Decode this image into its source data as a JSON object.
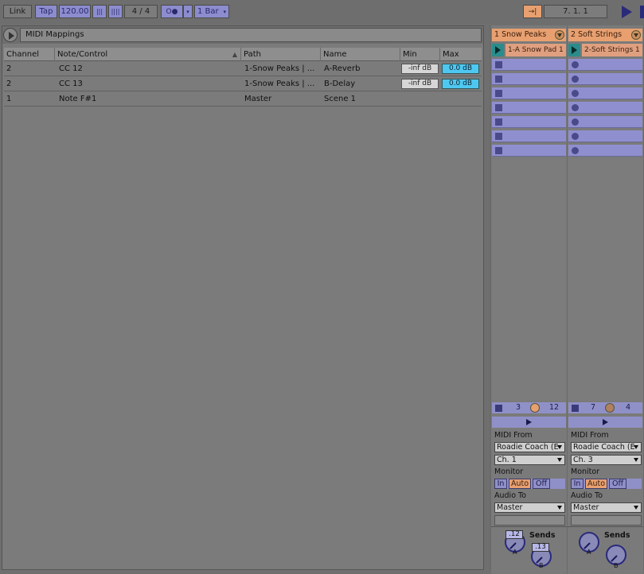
{
  "toolbar": {
    "link_label": "Link",
    "tap_label": "Tap",
    "tempo": "120.00",
    "time_signature": "4 / 4",
    "follow_symbol": "O●",
    "quantize": "1 Bar",
    "position": "7.  1.  1",
    "accent_color": "#8c8ccf",
    "orange_color": "#e8a070"
  },
  "midi_panel": {
    "title": "MIDI Mappings",
    "columns": [
      "Channel",
      "Note/Control",
      "Path",
      "Name",
      "Min",
      "Max"
    ],
    "rows": [
      {
        "channel": "2",
        "control": "CC 12",
        "path": "1-Snow Peaks | ...",
        "name": "A-Reverb",
        "min": "-inf dB",
        "max": "0.0 dB"
      },
      {
        "channel": "2",
        "control": "CC 13",
        "path": "1-Snow Peaks | ...",
        "name": "B-Delay",
        "min": "-inf dB",
        "max": "0.0 dB"
      },
      {
        "channel": "1",
        "control": "Note F#1",
        "path": "Master",
        "name": "Scene 1",
        "min": "",
        "max": ""
      }
    ]
  },
  "tracks": [
    {
      "name": "1 Snow Peaks",
      "clip": "1-A Snow Pad 1",
      "slot_icon": "stop-square-icon",
      "meter_left": "3",
      "meter_right": "12",
      "midi_from_label": "MIDI From",
      "midi_from": "Roadie Coach (E",
      "channel": "Ch. 1",
      "monitor_label": "Monitor",
      "monitor": [
        "In",
        "Auto",
        "Off"
      ],
      "audio_to_label": "Audio To",
      "audio_to": "Master",
      "sends_label": "Sends",
      "send_a": ".12",
      "send_b": ".13",
      "knob_a": "A",
      "knob_b": "B"
    },
    {
      "name": "2 Soft Strings",
      "clip": "2-Soft Strings 1",
      "slot_icon": "record-circle-icon",
      "meter_left": "7",
      "meter_right": "4",
      "midi_from_label": "MIDI From",
      "midi_from": "Roadie Coach (E",
      "channel": "Ch. 3",
      "monitor_label": "Monitor",
      "monitor": [
        "In",
        "Auto",
        "Off"
      ],
      "audio_to_label": "Audio To",
      "audio_to": "Master",
      "sends_label": "Sends",
      "knob_a": "A",
      "knob_b": "B"
    }
  ]
}
